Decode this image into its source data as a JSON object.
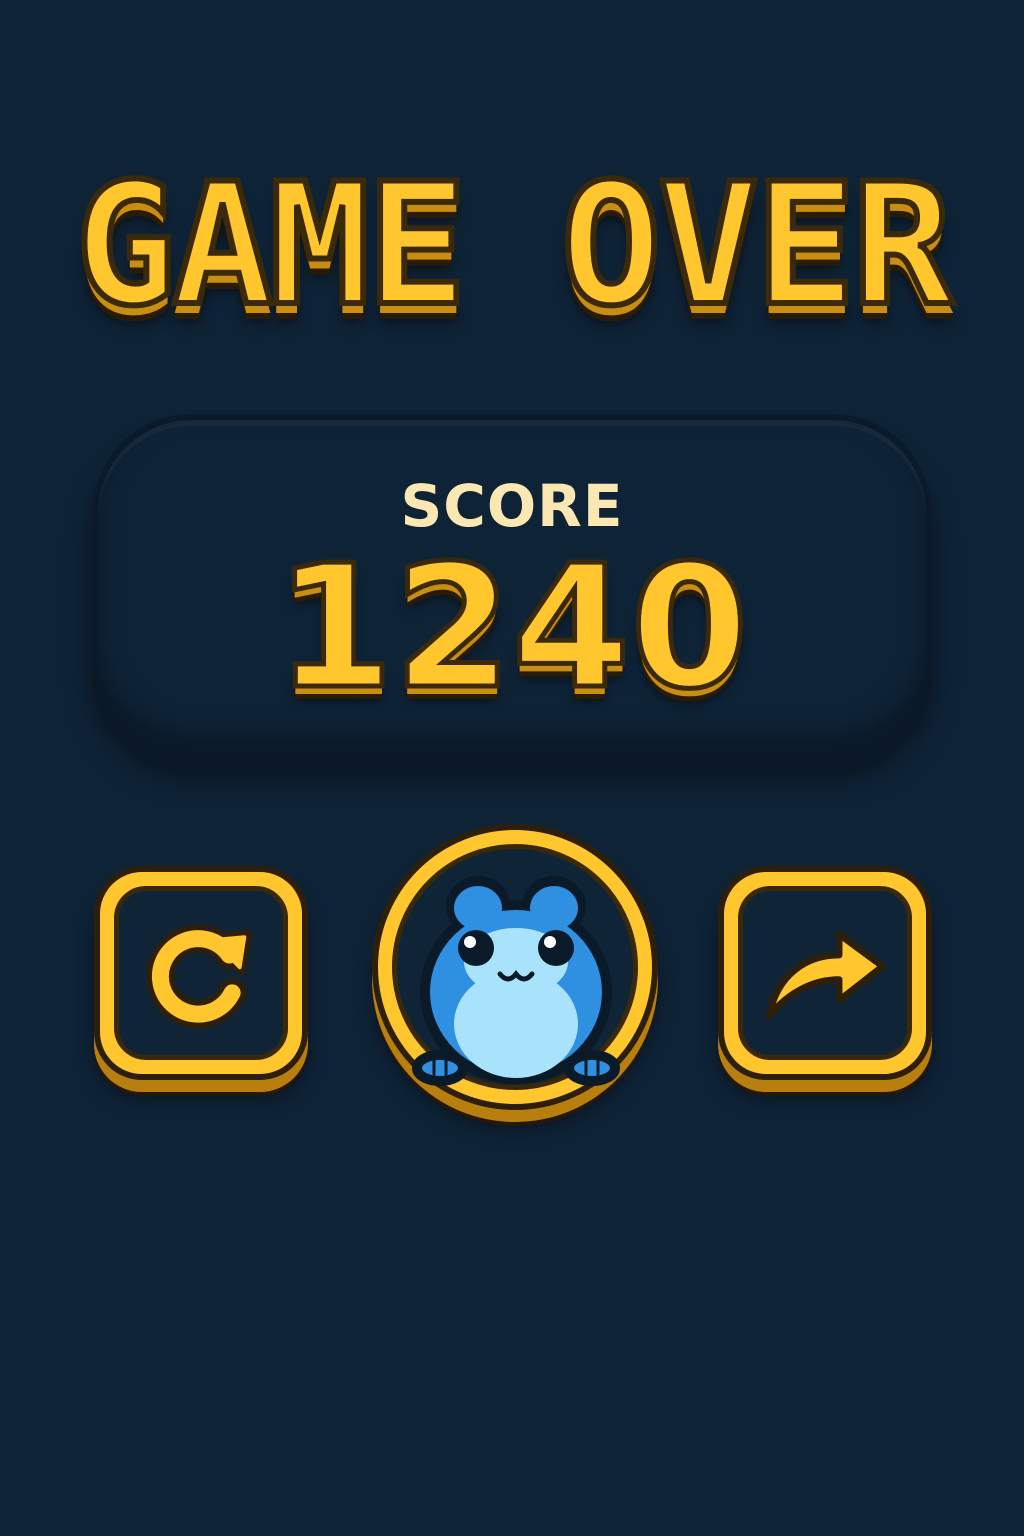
{
  "screen": {
    "title": "GAME OVER",
    "score_label": "SCORE",
    "score_value": "1240"
  },
  "buttons": {
    "restart_icon": "restart-icon",
    "character_icon": "frog-icon",
    "share_icon": "share-arrow-icon"
  },
  "colors": {
    "background": "#0f2337",
    "accent": "#ffc62e",
    "frog": "#2f8fe0"
  }
}
